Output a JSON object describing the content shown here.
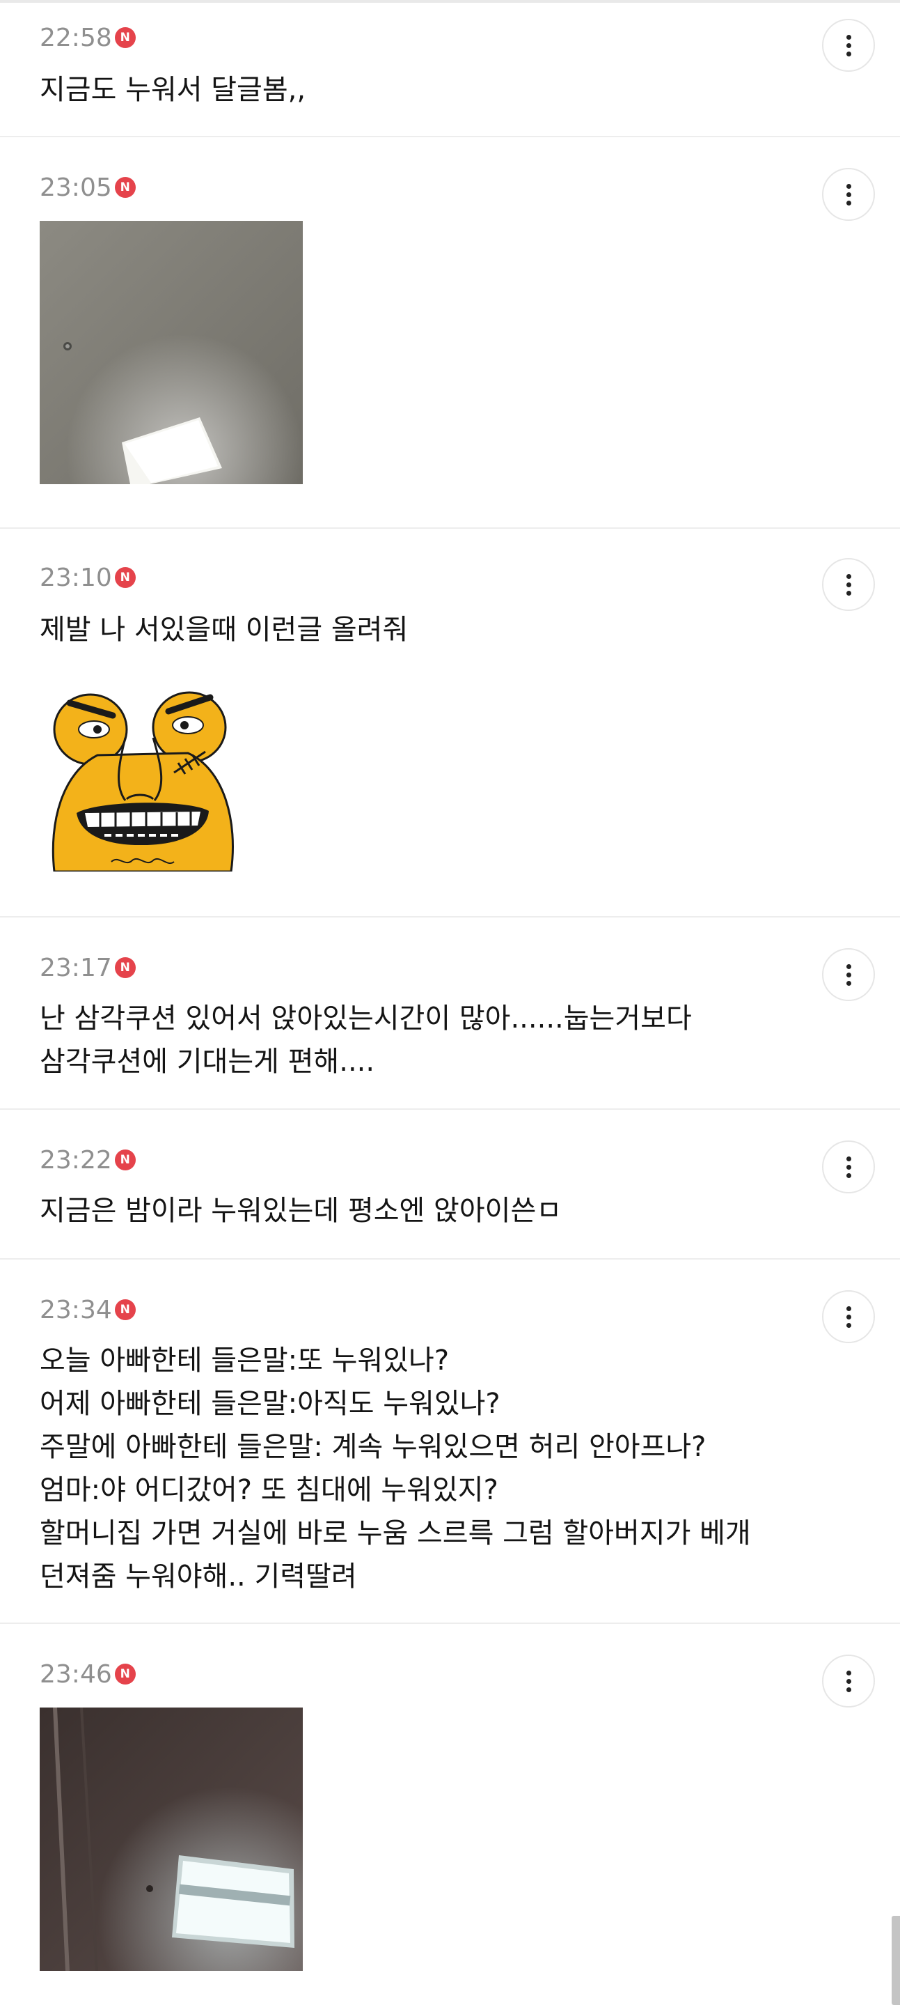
{
  "comments": [
    {
      "time": "22:58",
      "badge": "N",
      "lines": [
        "지금도 누워서 달글봄,,"
      ]
    },
    {
      "time": "23:05",
      "badge": "N",
      "image": "ceiling-light-photo"
    },
    {
      "time": "23:10",
      "badge": "N",
      "lines": [
        "제발 나 서있을때 이런글 올려줘"
      ],
      "sticker": "angry-yellow-character-sticker"
    },
    {
      "time": "23:17",
      "badge": "N",
      "lines": [
        "난 삼각쿠션 있어서 앉아있는시간이 많아......눕는거보다",
        "삼각쿠션에 기대는게 편해...."
      ]
    },
    {
      "time": "23:22",
      "badge": "N",
      "lines": [
        "지금은 밤이라 누워있는데 평소엔 앉아이쓴ㅁ"
      ]
    },
    {
      "time": "23:34",
      "badge": "N",
      "lines": [
        "오늘 아빠한테 들은말:또 누워있나?",
        "어제 아빠한테 들은말:아직도 누워있나?",
        "주말에 아빠한테 들은말: 계속 누워있으면 허리 안아프나?",
        "엄마:야 어디갔어? 또 침대에 누워있지?",
        "할머니집 가면 거실에 바로 누움 스르륵 그럼 할아버지가 베개",
        "던져줌 누워야해.. 기력딸려"
      ]
    },
    {
      "time": "23:46",
      "badge": "N",
      "image": "ceiling-light-photo-dark"
    }
  ],
  "icons": {
    "more": "more-vertical-icon",
    "new": "new-badge-icon"
  },
  "colors": {
    "badge": "#e5434b",
    "time": "#8f8f8f",
    "divider": "#ededed"
  }
}
